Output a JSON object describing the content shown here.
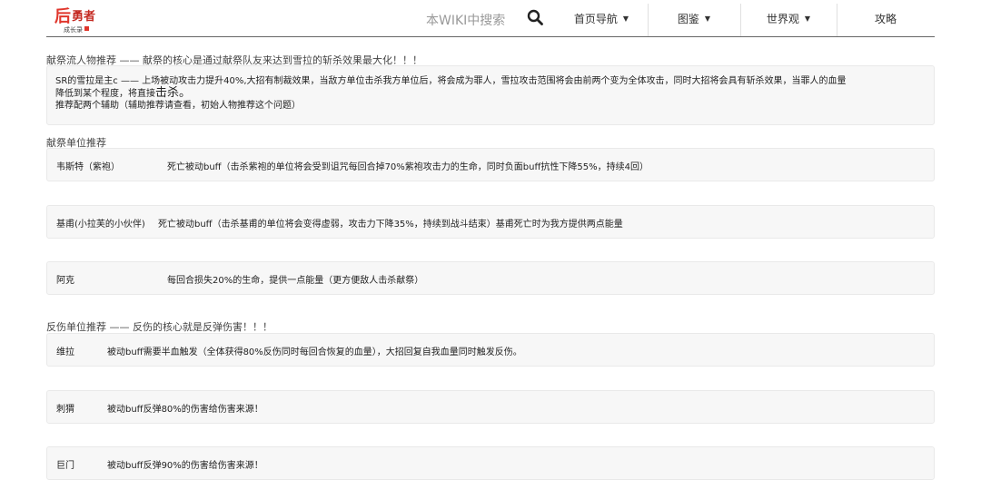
{
  "header": {
    "logo_text": "后勇者 成长录",
    "search_placeholder": "本WIKI中搜索",
    "nav": [
      {
        "label": "首页导航",
        "has_dropdown": true
      },
      {
        "label": "图鉴",
        "has_dropdown": true
      },
      {
        "label": "世界观",
        "has_dropdown": true
      },
      {
        "label": "攻略",
        "has_dropdown": false
      }
    ]
  },
  "sacrifice_section": {
    "heading": "献祭流人物推荐 —— 献祭的核心是通过献祭队友来达到雪拉的斩杀效果最大化！！！",
    "intro_line1": "SR的雪拉是主c —— 上场被动攻击力提升40%,大招有制裁效果，当敌方单位击杀我方单位后，将会成为罪人，雪拉攻击范围将会由前两个变为全体攻击，同时大招将会具有斩杀效果，当罪人的血量",
    "intro_line2a": "降低到某个程度，将直接",
    "intro_line2b": "击杀。",
    "intro_line3": "推荐配两个辅助（辅助推荐请查看，初始人物推荐这个问题）"
  },
  "sacrifice_units": {
    "heading": "献祭单位推荐",
    "items": [
      {
        "name": "韦斯特（紫袍）",
        "desc": "死亡被动buff（击杀紫袍的单位将会受到诅咒每回合掉70%紫袍攻击力的生命，同时负面buff抗性下降55%，持续4回）"
      },
      {
        "name": "基甫(小拉芙的小伙伴)",
        "desc": "死亡被动buff（击杀基甫的单位将会变得虚弱，攻击力下降35%，持续到战斗结束）基甫死亡时为我方提供两点能量"
      },
      {
        "name": "阿克",
        "desc": "每回合损失20%的生命，提供一点能量（更方便敌人击杀献祭）"
      }
    ]
  },
  "reflect_units": {
    "heading": "反伤单位推荐 —— 反伤的核心就是反弹伤害！！！",
    "items": [
      {
        "name": "维拉",
        "desc": "被动buff需要半血触发（全体获得80%反伤同时每回合恢复的血量），大招回复自我血量同时触发反伤。"
      },
      {
        "name": "刺猬",
        "desc": "被动buff反弹80%的伤害给伤害来源！"
      },
      {
        "name": "巨门",
        "desc": "被动buff反弹90%的伤害给伤害来源！"
      }
    ]
  },
  "colors": {
    "accent_logo": "#e0362c",
    "box_bg": "#f7f7f7",
    "rule": "#666666"
  }
}
